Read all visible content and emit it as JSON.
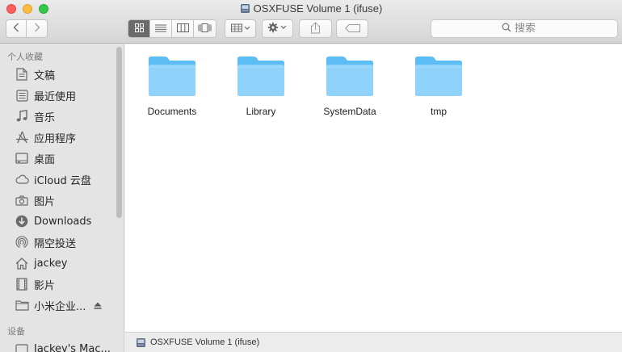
{
  "window": {
    "title": "OSXFUSE Volume 1 (ifuse)"
  },
  "toolbar": {
    "back_icon": "chevron-left-icon",
    "forward_icon": "chevron-right-icon",
    "view_modes": [
      "icon-view",
      "list-view",
      "column-view",
      "cover-flow-view"
    ],
    "active_view": "icon-view",
    "arrange_icon": "arrange-grid-icon",
    "action_icon": "gear-icon",
    "share_icon": "share-icon",
    "tag_icon": "tag-icon",
    "search_placeholder": "搜索"
  },
  "sidebar": {
    "favorites_header": "个人收藏",
    "favorites": [
      {
        "label": "文稿",
        "icon": "document-icon"
      },
      {
        "label": "最近使用",
        "icon": "recents-icon"
      },
      {
        "label": "音乐",
        "icon": "music-note-icon"
      },
      {
        "label": "应用程序",
        "icon": "applications-icon"
      },
      {
        "label": "桌面",
        "icon": "desktop-icon"
      },
      {
        "label": "iCloud 云盘",
        "icon": "cloud-icon"
      },
      {
        "label": "图片",
        "icon": "camera-icon"
      },
      {
        "label": "Downloads",
        "icon": "download-icon"
      },
      {
        "label": "隔空投送",
        "icon": "airdrop-icon"
      },
      {
        "label": "jackey",
        "icon": "home-icon"
      },
      {
        "label": "影片",
        "icon": "film-icon"
      },
      {
        "label": "小米企业...",
        "icon": "folder-icon"
      }
    ],
    "devices_header": "设备",
    "devices": [
      {
        "label": "Jackey's Mac...",
        "icon": "computer-icon"
      }
    ]
  },
  "main": {
    "items": [
      {
        "label": "Documents",
        "icon": "folder-icon"
      },
      {
        "label": "Library",
        "icon": "folder-icon"
      },
      {
        "label": "SystemData",
        "icon": "folder-icon"
      },
      {
        "label": "tmp",
        "icon": "folder-icon"
      }
    ]
  },
  "pathbar": {
    "label": "OSXFUSE Volume 1 (ifuse)"
  },
  "colors": {
    "folder_light": "#8fd3fb",
    "folder_dark": "#5cbcf4",
    "close": "#fc605c",
    "minimize": "#fdbc40",
    "maximize": "#34c84a"
  }
}
